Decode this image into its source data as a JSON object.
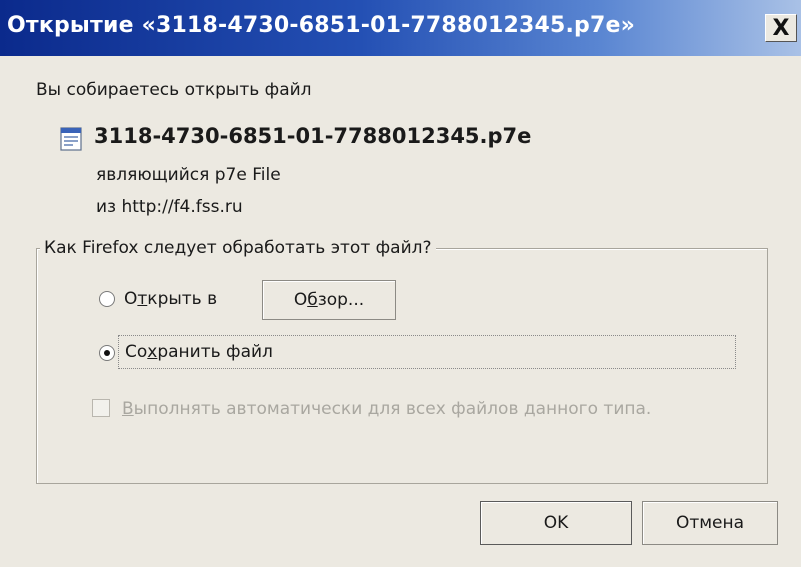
{
  "window": {
    "title": "Открытие «3118-4730-6851-01-7788012345.p7e»",
    "close_label": "X"
  },
  "intro_text": "Вы собираетесь открыть файл",
  "file": {
    "name": "3118-4730-6851-01-7788012345.p7e",
    "type_text": "являющийся  p7e File",
    "source_text": "из  http://f4.fss.ru",
    "icon": "file-icon"
  },
  "group": {
    "legend": "Как Firefox следует обработать этот файл?",
    "open_with": {
      "pre": "О",
      "ul": "т",
      "post": "крыть в",
      "checked": false
    },
    "browse_button": {
      "pre": "О",
      "ul": "б",
      "post": "зор..."
    },
    "save_file": {
      "pre": "Со",
      "ul": "х",
      "post": "ранить файл",
      "checked": true
    },
    "auto_checkbox": {
      "pre": "",
      "ul": "В",
      "post": "ыполнять автоматически для всех файлов данного типа.",
      "checked": false,
      "enabled": false
    }
  },
  "buttons": {
    "ok": "OK",
    "cancel": "Отмена"
  }
}
